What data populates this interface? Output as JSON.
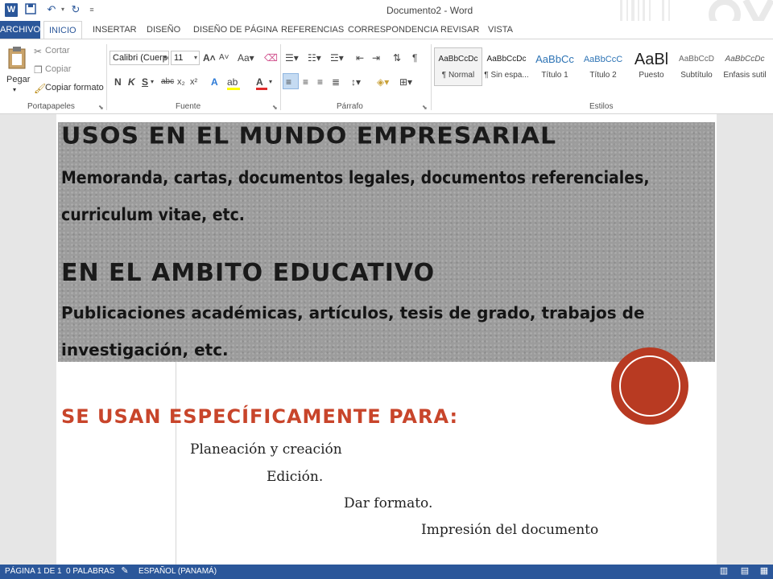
{
  "titlebar": {
    "title": "Documento2 - Word",
    "app_icon": "word-icon",
    "quick_access": [
      "save-icon",
      "undo-icon",
      "redo-icon",
      "customize-icon"
    ]
  },
  "ribbon": {
    "tabs": [
      "ARCHIVO",
      "INICIO",
      "INSERTAR",
      "DISEÑO",
      "DISEÑO DE PÁGINA",
      "REFERENCIAS",
      "CORRESPONDENCIA",
      "REVISAR",
      "VISTA"
    ],
    "active_tab": "INICIO",
    "clipboard": {
      "paste": "Pegar",
      "cut": "Cortar",
      "copy": "Copiar",
      "format_painter": "Copiar formato",
      "label": "Portapapeles"
    },
    "font": {
      "family": "Calibri (Cuerpo",
      "size": "11",
      "label": "Fuente"
    },
    "paragraph": {
      "label": "Párrafo"
    },
    "styles": {
      "label": "Estilos",
      "items": [
        {
          "sample": "AaBbCcDc",
          "name": "¶ Normal"
        },
        {
          "sample": "AaBbCcDc",
          "name": "¶ Sin espa..."
        },
        {
          "sample": "AaBbCc",
          "name": "Título 1"
        },
        {
          "sample": "AaBbCcC",
          "name": "Título 2"
        },
        {
          "sample": "AaBl",
          "name": "Puesto"
        },
        {
          "sample": "AaBbCcD",
          "name": "Subtítulo"
        },
        {
          "sample": "AaBbCcDc",
          "name": "Énfasis sutil"
        }
      ]
    }
  },
  "document": {
    "heading1": "Usos en el mundo empresarial",
    "body1": "Memoranda, cartas, documentos legales, documentos referenciales, curriculum vitae, etc.",
    "heading2": "En el ambito educativo",
    "body2": "Publicaciones académicas, artículos, tesis de grado, trabajos de investigación, etc.",
    "heading3": "Se usan específicamente para:",
    "list": [
      "Planeación y creación",
      "Edición.",
      "Dar formato.",
      "Impresión del documento"
    ]
  },
  "statusbar": {
    "page": "PÁGINA 1 DE 1",
    "words": "0 PALABRAS",
    "language": "ESPAÑOL (PANAMÁ)"
  },
  "colors": {
    "word_blue": "#2b579a",
    "accent_red": "#c8452b",
    "seal_red": "#b83a22",
    "textured_gray": "#9c9c9c"
  }
}
